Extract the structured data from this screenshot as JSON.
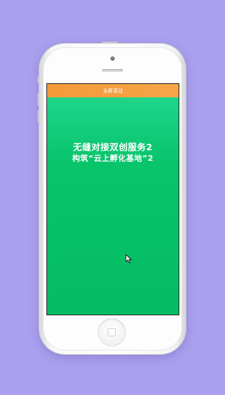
{
  "topbar": {
    "label": "全屏滚动"
  },
  "content": {
    "headline_line1": "无缝对接双创服务2",
    "headline_line2": "构筑“云上孵化基地”2"
  },
  "colors": {
    "background": "#a9a0ef",
    "topbar": "#f39a3a",
    "screen_green": "#06bd63",
    "text": "#ffffff"
  },
  "icons": {
    "cursor": "mouse-pointer-icon",
    "home": "home-button-icon"
  }
}
